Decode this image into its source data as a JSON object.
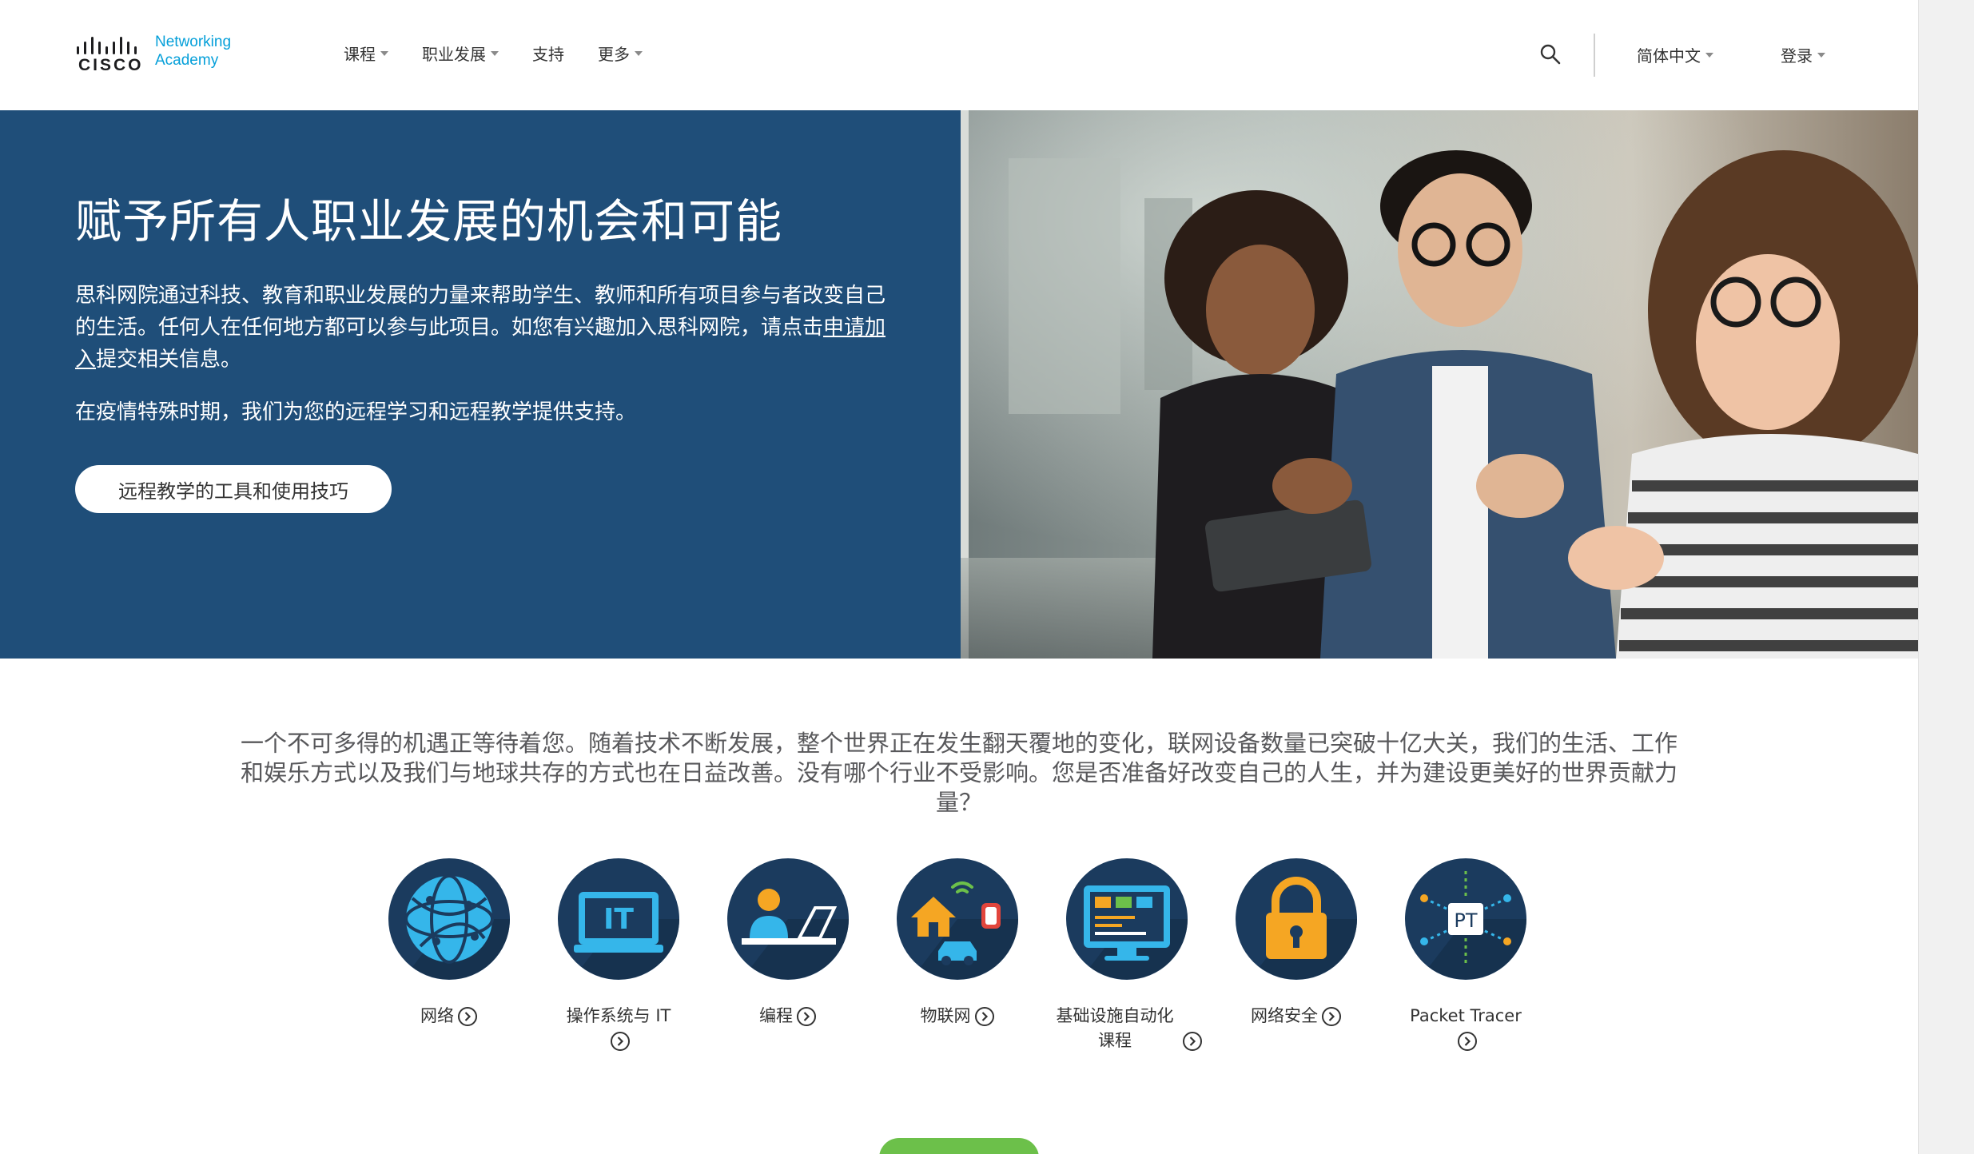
{
  "brand": {
    "logo_word": "CISCO",
    "logo_sub_line1": "Networking",
    "logo_sub_line2": "Academy",
    "accent_color": "#049fd9",
    "hero_color": "#1f4e79"
  },
  "nav": {
    "items": [
      {
        "label": "课程",
        "has_dropdown": true
      },
      {
        "label": "职业发展",
        "has_dropdown": true
      },
      {
        "label": "支持",
        "has_dropdown": false
      },
      {
        "label": "更多",
        "has_dropdown": true
      }
    ],
    "search_icon": "search-icon",
    "language": "简体中文",
    "login": "登录"
  },
  "hero": {
    "title": "赋予所有人职业发展的机会和可能",
    "para1_before": "思科网院通过科技、教育和职业发展的力量来帮助学生、教师和所有项目参与者改变自己的生活。任何人在任何地方都可以参与此项目。如您有兴趣加入思科网院，请点击",
    "para1_link": "申请加入",
    "para1_after": "提交相关信息。",
    "para2": "在疫情特殊时期，我们为您的远程学习和远程教学提供支持。",
    "button": "远程教学的工具和使用技巧"
  },
  "intro": "一个不可多得的机遇正等待着您。随着技术不断发展，整个世界正在发生翻天覆地的变化，联网设备数量已突破十亿大关，我们的生活、工作和娱乐方式以及我们与地球共存的方式也在日益改善。没有哪个行业不受影响。您是否准备好改变自己的人生，并为建设更美好的世界贡献力量？",
  "topics": [
    {
      "label": "网络",
      "icon": "globe-network-icon"
    },
    {
      "label": "操作系统与 IT",
      "icon": "it-monitor-icon"
    },
    {
      "label": "编程",
      "icon": "person-laptop-icon"
    },
    {
      "label": "物联网",
      "icon": "iot-devices-icon"
    },
    {
      "label": "基础设施自动化课程",
      "icon": "code-monitor-icon"
    },
    {
      "label": "网络安全",
      "icon": "padlock-icon"
    },
    {
      "label": "Packet Tracer",
      "icon": "packet-tracer-icon"
    }
  ]
}
